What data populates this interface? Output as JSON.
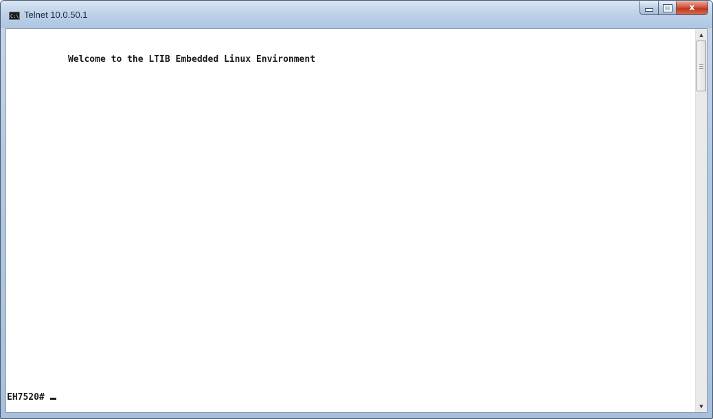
{
  "window": {
    "title": "Telnet 10.0.50.1",
    "app_icon": "console-icon",
    "app_icon_text": "C:\\."
  },
  "caption_buttons": {
    "minimize": "minimize-icon",
    "maximize": "maximize-icon",
    "close": "close-icon",
    "close_glyph": "x"
  },
  "terminal": {
    "welcome_line": "Welcome to the LTIB Embedded Linux Environment",
    "prompt": "EH7520#",
    "text_color": "#1a1a1a",
    "background_color": "#ffffff"
  },
  "scrollbar": {
    "up_arrow": "▲",
    "down_arrow": "▼"
  }
}
